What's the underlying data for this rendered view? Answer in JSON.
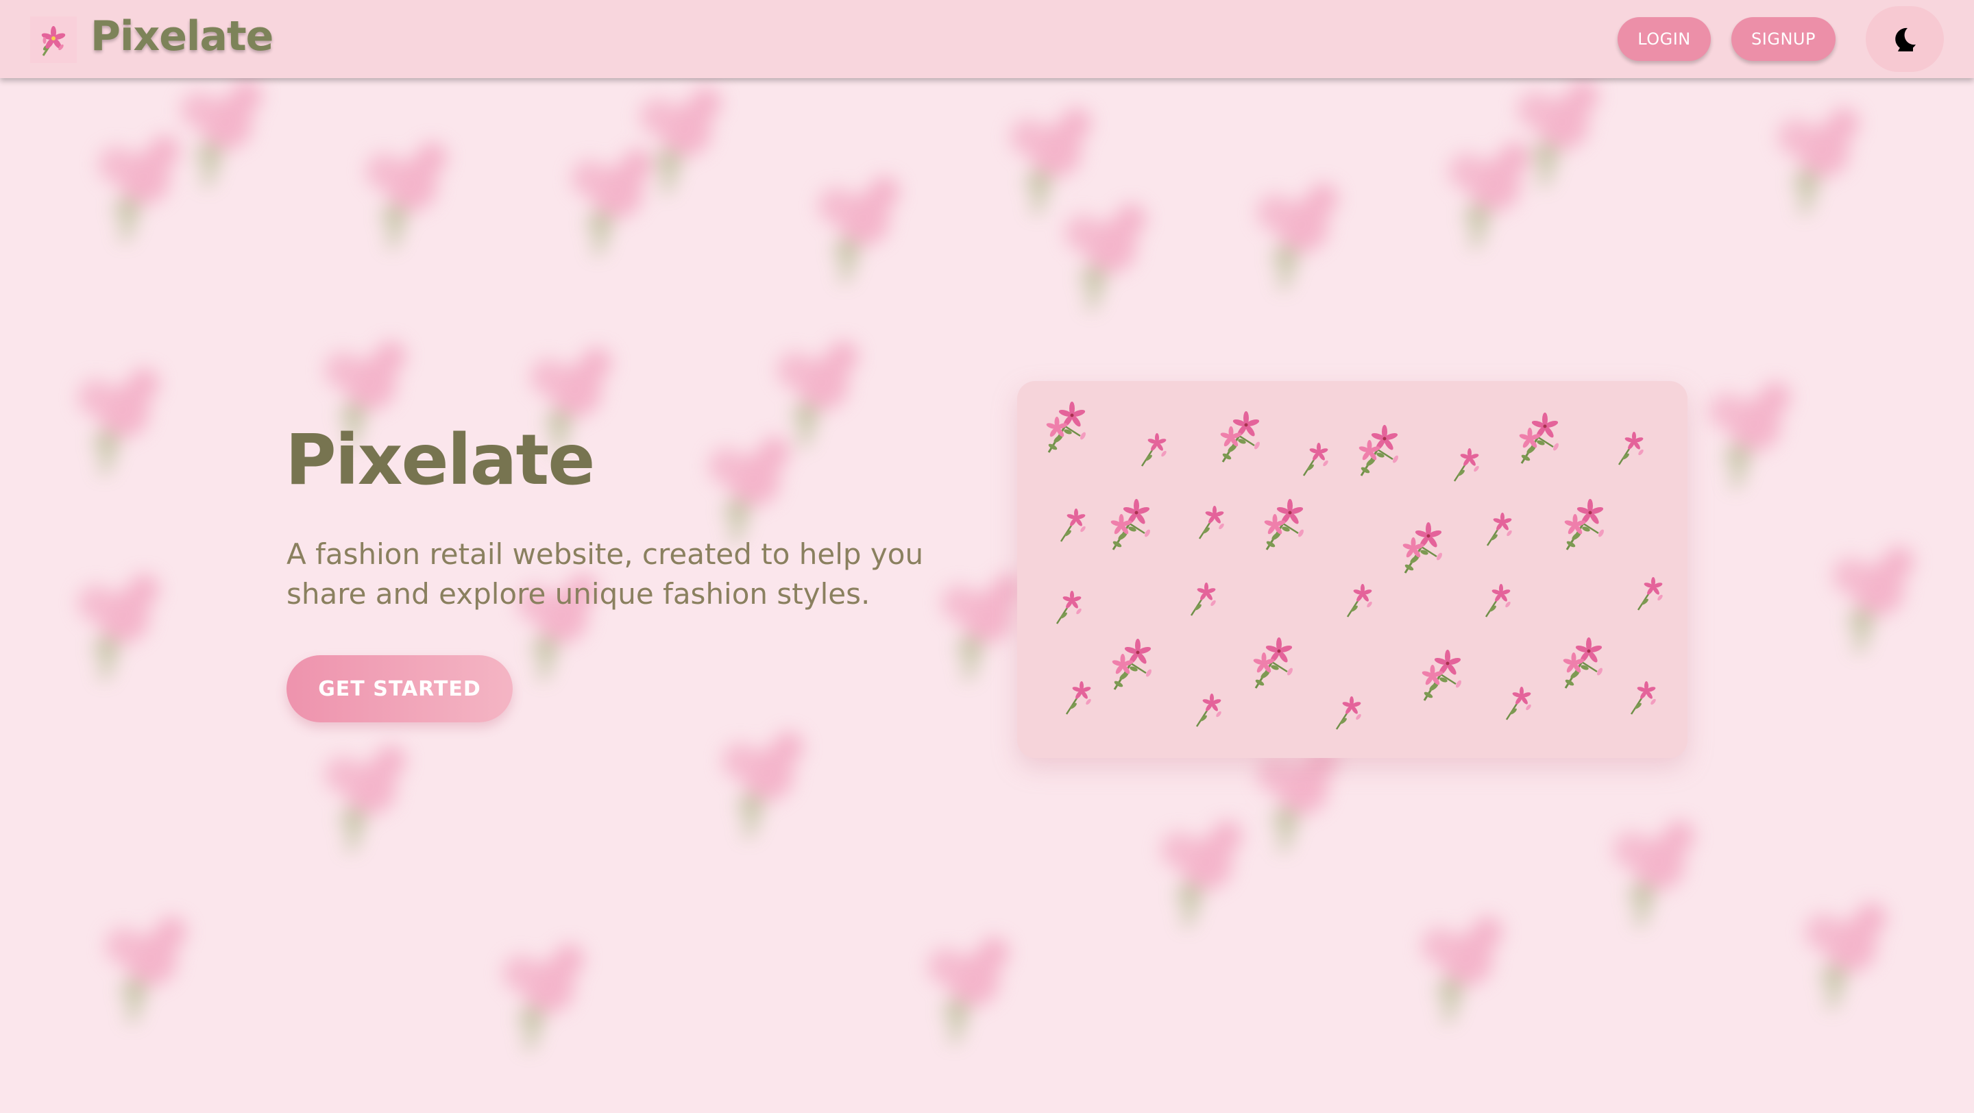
{
  "navbar": {
    "logo_icon": "flower-icon",
    "brand": "Pixelate",
    "login_label": "LOGIN",
    "signup_label": "SIGNUP",
    "theme_icon": "moon-icon"
  },
  "hero": {
    "title": "Pixelate",
    "description": "A fashion retail website, created to help you share and explore unique fashion styles.",
    "cta_label": "GET STARTED",
    "image_icon": "floral-pattern-illustration"
  },
  "colors": {
    "navbar_bg": "#f8d6dd",
    "page_bg": "#fbe6ec",
    "brand_text": "#7d8359",
    "button_pink": "#ec8fa8",
    "flower_pink": "#e4639a",
    "leaf_green": "#7d9a52"
  }
}
